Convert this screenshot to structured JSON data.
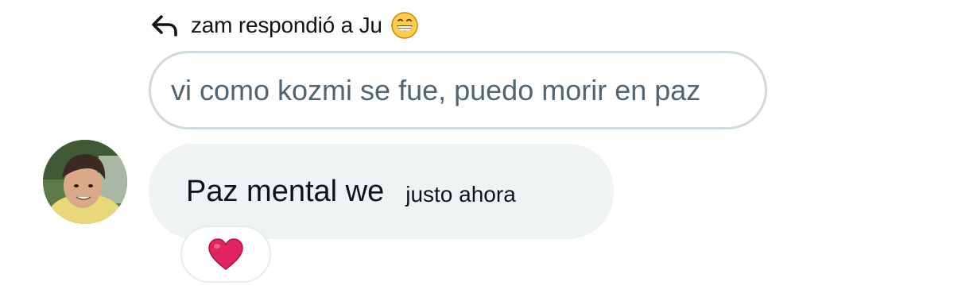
{
  "reply_header": {
    "text": "zam respondió a Ju",
    "arrow_icon": "reply-arrow-icon",
    "emoji_icon": "grinning-face-emoji"
  },
  "quoted_message": {
    "text": "vi como kozmi se fue, puedo morir en paz"
  },
  "message": {
    "text": "Paz mental we",
    "timestamp": "justo ahora",
    "avatar": "user-avatar"
  },
  "reaction": {
    "emoji": "heart-emoji",
    "color": "#e0245e"
  },
  "colors": {
    "bubble_bg": "#eff3f4",
    "quote_border": "#cfd9de",
    "quote_text": "#536471",
    "primary_text": "#0f1419"
  }
}
